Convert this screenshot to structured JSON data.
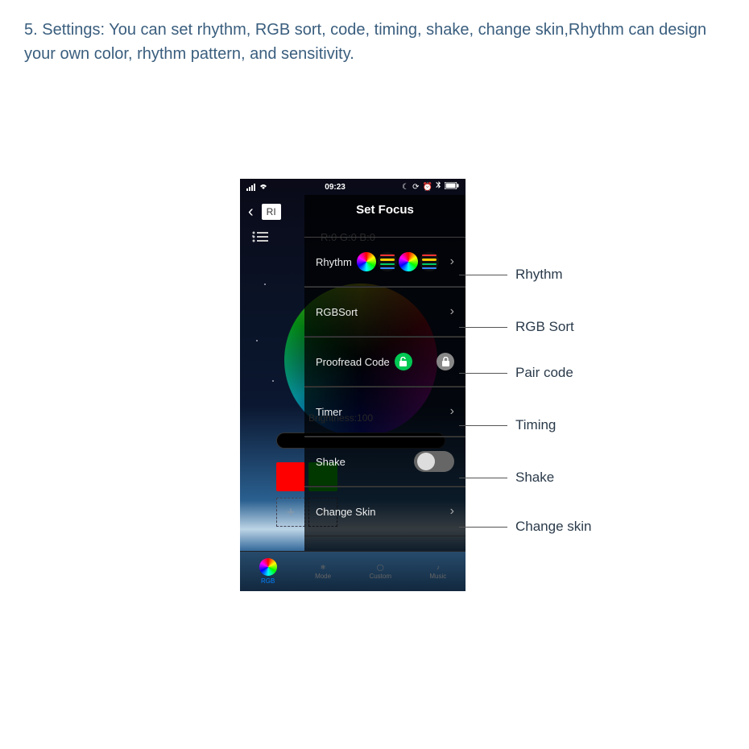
{
  "instruction": "5. Settings: You can set rhythm, RGB sort, code, timing, shake, change skin,Rhythm can design your own color, rhythm pattern, and sensitivity.",
  "status": {
    "time": "09:23"
  },
  "header": {
    "mode_tab": "RI"
  },
  "rgb_readout": "R:0 G:0 B:0",
  "brightness": {
    "label": "Brightness:100"
  },
  "overlay": {
    "title": "Set Focus",
    "items": {
      "rhythm": "Rhythm",
      "rgbsort": "RGBSort",
      "proofread": "Proofread Code",
      "timer": "Timer",
      "shake": "Shake",
      "change_skin": "Change Skin"
    }
  },
  "nav": {
    "rgb": "RGB",
    "mode": "Mode",
    "custom": "Custom",
    "music": "Music"
  },
  "callouts": {
    "rhythm": "Rhythm",
    "rgbsort": "RGB Sort",
    "paircode": "Pair code",
    "timing": "Timing",
    "shake": "Shake",
    "changeskin": "Change skin"
  },
  "glyphs": {
    "chevron_right": "›",
    "chevron_left": "‹",
    "plus": "+"
  }
}
